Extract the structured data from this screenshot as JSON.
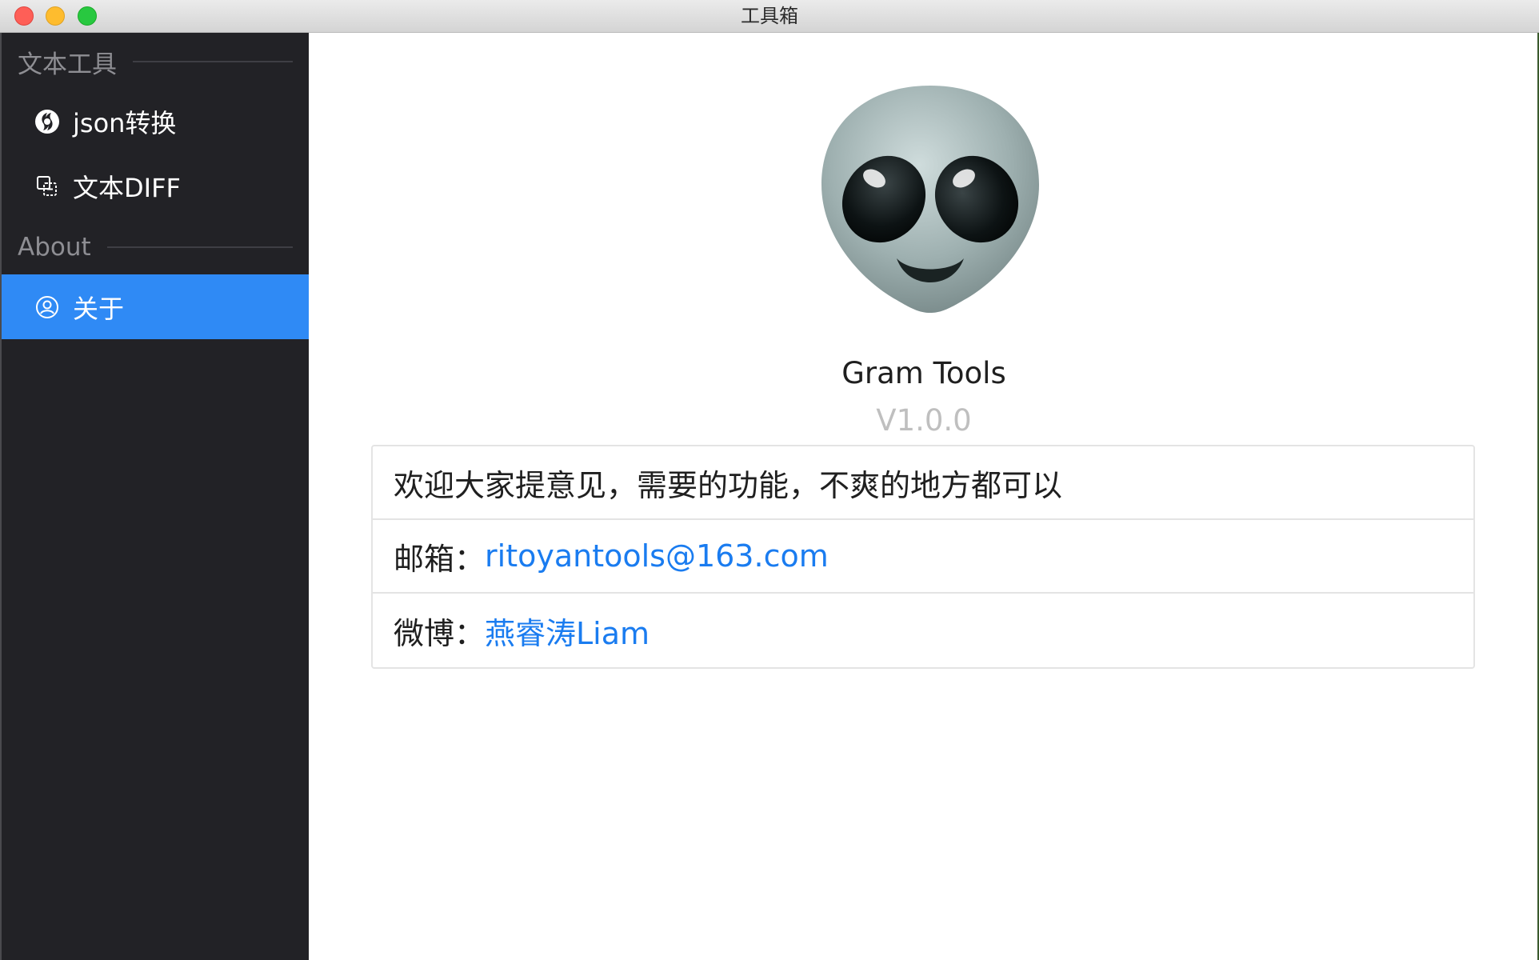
{
  "window": {
    "title": "工具箱",
    "traffic_lights": [
      "close",
      "minimize",
      "zoom"
    ]
  },
  "sidebar": {
    "groups": [
      {
        "title": "文本工具",
        "items": [
          {
            "label": "json转换",
            "icon": "json-logo-icon"
          },
          {
            "label": "文本DIFF",
            "icon": "diff-icon"
          }
        ]
      },
      {
        "title": "About",
        "items": [
          {
            "label": "关于",
            "icon": "user-circle-icon",
            "active": true
          }
        ]
      }
    ]
  },
  "about": {
    "avatar_icon": "alien-emoji-icon",
    "app_name": "Gram Tools",
    "version": "V1.0.0",
    "welcome": "欢迎大家提意见，需要的功能，不爽的地方都可以",
    "email_label": "邮箱：",
    "email": "ritoyantools@163.com",
    "weibo_label": "微博：",
    "weibo": "燕睿涛Liam"
  },
  "colors": {
    "sidebar_bg": "#222226",
    "active_item": "#2f8af5",
    "link": "#1a7cf0",
    "version_text": "#bfbfbf"
  }
}
